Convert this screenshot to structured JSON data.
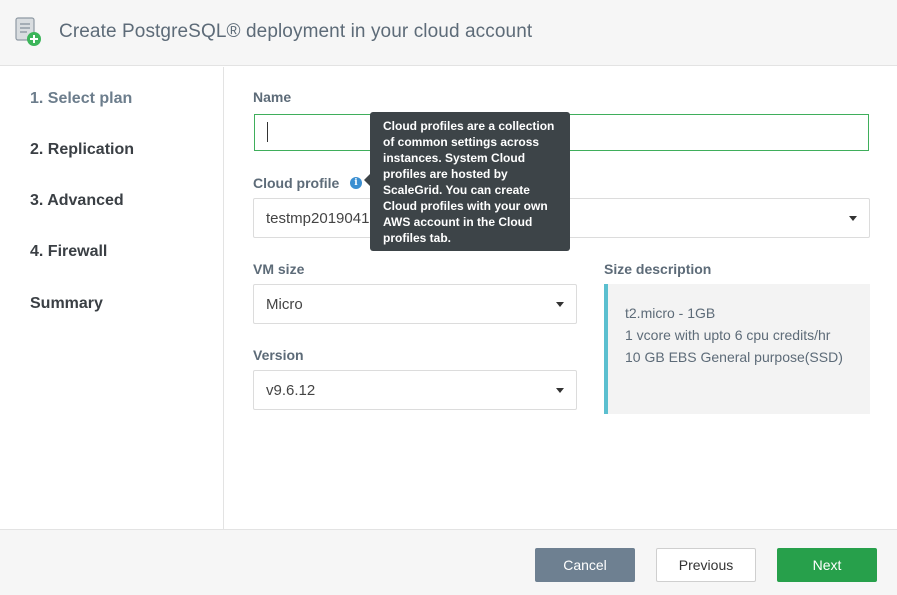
{
  "header": {
    "title": "Create PostgreSQL® deployment in your cloud account",
    "icon": "document-add-icon"
  },
  "sidebar": {
    "steps": [
      {
        "label": "1. Select plan",
        "active": true
      },
      {
        "label": "2. Replication",
        "active": false
      },
      {
        "label": "3. Advanced",
        "active": false
      },
      {
        "label": "4. Firewall",
        "active": false
      },
      {
        "label": "Summary",
        "active": false
      }
    ]
  },
  "form": {
    "name": {
      "label": "Name",
      "value": ""
    },
    "cloud_profile": {
      "label": "Cloud profile",
      "value": "testmp20190416"
    },
    "vm_size": {
      "label": "VM size",
      "value": "Micro"
    },
    "version": {
      "label": "Version",
      "value": "v9.6.12"
    },
    "size_description": {
      "label": "Size description",
      "lines": [
        "t2.micro - 1GB",
        "1 vcore with upto 6 cpu credits/hr",
        "10 GB EBS General purpose(SSD)"
      ]
    }
  },
  "tooltip": {
    "text": "Cloud profiles are a collection of common settings across instances. System Cloud profiles are hosted by ScaleGrid. You can create Cloud profiles with your own AWS account in the Cloud profiles tab."
  },
  "footer": {
    "cancel_label": "Cancel",
    "previous_label": "Previous",
    "next_label": "Next"
  },
  "colors": {
    "accent_green": "#27a04b",
    "input_focus_border": "#3fae5b",
    "desc_border": "#5bbfcf",
    "cancel_bg": "#6e8091",
    "info_icon": "#3b8fd1"
  }
}
